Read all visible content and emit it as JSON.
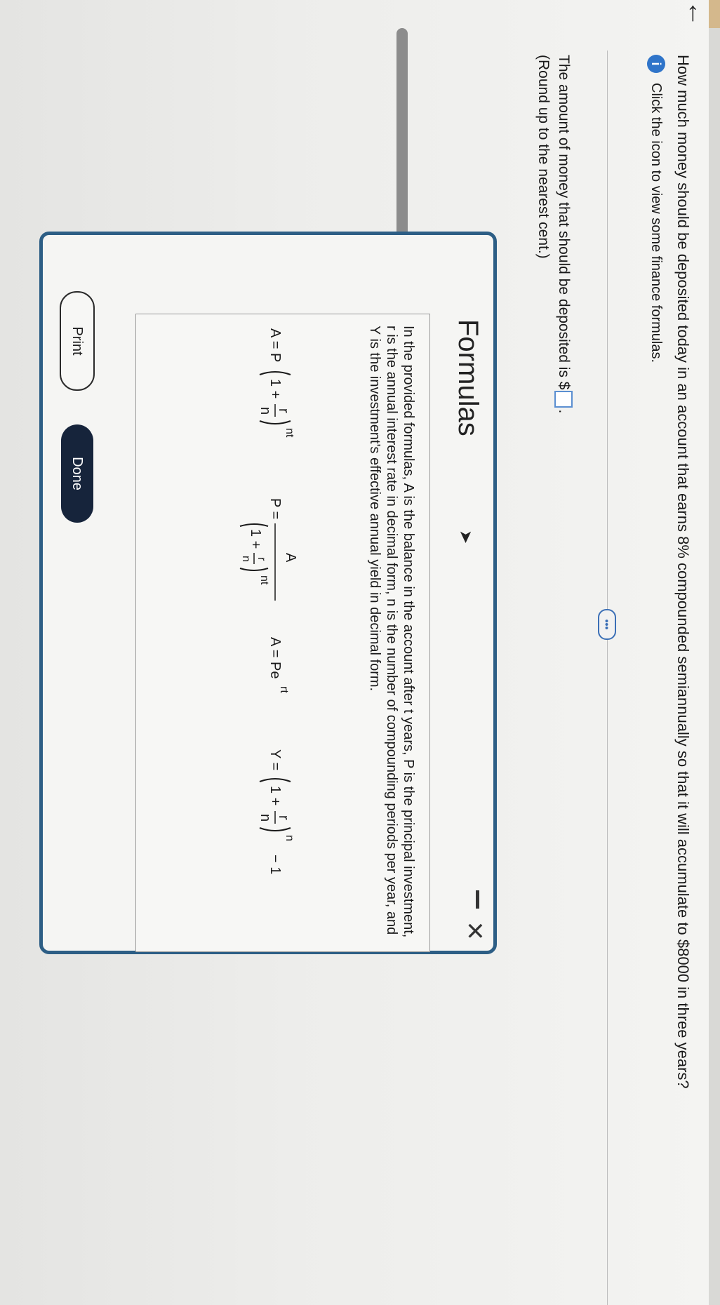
{
  "nav": {
    "back_glyph": "←"
  },
  "question": {
    "text": "How much money should be deposited today in an account that earns 8% compounded semiannually so that it will accumulate to $8000 in three years?",
    "info_icon": "info-icon",
    "info_glyph": "i",
    "info_text": "Click the icon to view some finance formulas.",
    "more_glyph": "•••"
  },
  "answer": {
    "prompt": "The amount of money that should be deposited is $",
    "value": "",
    "suffix": ".",
    "note": "(Round up to the nearest cent.)"
  },
  "dialog": {
    "title": "Formulas",
    "minimize_glyph": "-",
    "close_glyph": "✕",
    "description": "In the provided formulas, A is the balance in the account after t years, P is the principal investment, r is the annual interest rate in decimal form, n is the number of compounding periods per year, and Y is the investment's effective annual yield in decimal form.",
    "formulas": {
      "f1": {
        "lhs": "A = P",
        "num": "r",
        "den": "n",
        "one": "1 +",
        "exp": "nt"
      },
      "f2": {
        "lhs": "P =",
        "top": "A",
        "num": "r",
        "den": "n",
        "one": "1 +",
        "exp": "nt"
      },
      "f3": {
        "lhs": "A = Pe",
        "exp": "rt"
      },
      "f4": {
        "lhs": "Y =",
        "num": "r",
        "den": "n",
        "one": "1 +",
        "exp": "n",
        "tail": "− 1"
      }
    },
    "print_label": "Print",
    "done_label": "Done"
  }
}
